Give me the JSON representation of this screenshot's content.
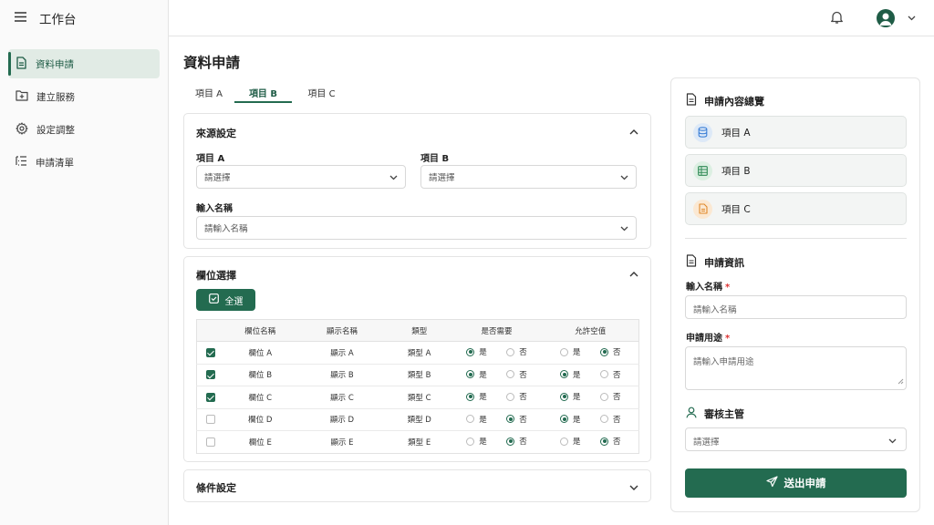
{
  "app": {
    "title": "工作台"
  },
  "sidebar": {
    "items": [
      {
        "label": "資料申請",
        "icon": "document-icon",
        "active": true
      },
      {
        "label": "建立服務",
        "icon": "folder-add-icon",
        "active": false
      },
      {
        "label": "設定調整",
        "icon": "gear-icon",
        "active": false
      },
      {
        "label": "申請清單",
        "icon": "list-icon",
        "active": false
      }
    ]
  },
  "page": {
    "title": "資料申請"
  },
  "tabs": [
    {
      "label": "項目 A"
    },
    {
      "label": "項目 B",
      "active": true
    },
    {
      "label": "項目 C"
    }
  ],
  "source": {
    "title": "來源設定",
    "item_a_label": "項目 A",
    "item_a_placeholder": "請選擇",
    "item_b_label": "項目 B",
    "item_b_placeholder": "請選擇",
    "name_label": "輸入名稱",
    "name_placeholder": "請輸入名稱"
  },
  "fields": {
    "title": "欄位選擇",
    "select_all": "全選",
    "columns": [
      "欄位名稱",
      "顯示名稱",
      "類型",
      "是否需要",
      "允許空值"
    ],
    "yes": "是",
    "no": "否",
    "rows": [
      {
        "checked": true,
        "name": "欄位 A",
        "display": "顯示 A",
        "type": "類型 A",
        "required": "yes",
        "nullable": "no"
      },
      {
        "checked": true,
        "name": "欄位 B",
        "display": "顯示 B",
        "type": "類型 B",
        "required": "yes",
        "nullable": "yes"
      },
      {
        "checked": true,
        "name": "欄位 C",
        "display": "顯示 C",
        "type": "類型 C",
        "required": "yes",
        "nullable": "yes"
      },
      {
        "checked": false,
        "name": "欄位 D",
        "display": "顯示 D",
        "type": "類型 D",
        "required": "no",
        "nullable": "yes"
      },
      {
        "checked": false,
        "name": "欄位 E",
        "display": "顯示 E",
        "type": "類型 E",
        "required": "no",
        "nullable": "no"
      }
    ]
  },
  "conditions": {
    "title": "條件設定"
  },
  "summary": {
    "title": "申請內容總覽",
    "items": [
      {
        "label": "項目 A",
        "icon": "database-icon",
        "color": "#3b7fd6",
        "bg": "#dde9f7"
      },
      {
        "label": "項目 B",
        "icon": "table-icon",
        "color": "#2e8a55",
        "bg": "#dcefe2"
      },
      {
        "label": "項目 C",
        "icon": "file-icon",
        "color": "#e08a2c",
        "bg": "#fbe8d2"
      }
    ]
  },
  "info": {
    "title": "申請資訊",
    "name_label": "輸入名稱",
    "name_placeholder": "請輸入名稱",
    "purpose_label": "申請用途",
    "purpose_placeholder": "請輸入申請用途",
    "supervisor_title": "審核主管",
    "supervisor_placeholder": "請選擇",
    "required_mark": "*",
    "submit": "送出申請"
  },
  "colors": {
    "accent": "#236b50",
    "accent_light": "#e1ebe5"
  }
}
